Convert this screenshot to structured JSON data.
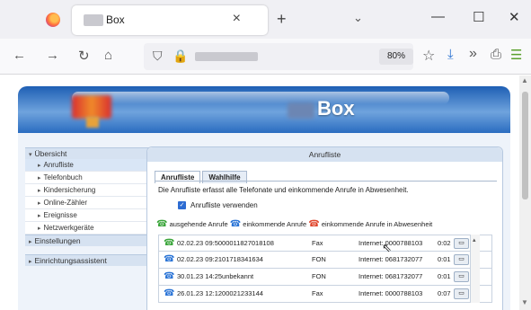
{
  "browser": {
    "tab_title": "Box",
    "tab_close": "×",
    "new_tab": "+",
    "tab_list": "⌄",
    "window_buttons": {
      "minimize": "—",
      "maximize": "☐",
      "close": "✕"
    },
    "nav": {
      "back": "←",
      "forward": "→",
      "reload": "↻",
      "home": "⌂"
    },
    "url_shield": "⛉",
    "url_lock": "🔒",
    "zoom_level": "80%",
    "toolbar": {
      "star": "☆",
      "download": "⤓",
      "more": "»",
      "share": "⎙",
      "extension": "☰"
    }
  },
  "page": {
    "banner_title": "Box",
    "sidebar": {
      "sections": [
        {
          "label": "Übersicht",
          "bullet": "▾",
          "items": [
            {
              "label": "Anrufliste",
              "active": true
            },
            {
              "label": "Telefonbuch"
            },
            {
              "label": "Kindersicherung"
            },
            {
              "label": "Online-Zähler"
            },
            {
              "label": "Ereignisse"
            },
            {
              "label": "Netzwerkgeräte"
            }
          ]
        },
        {
          "label": "Einstellungen",
          "bullet": "▸",
          "items": []
        },
        {
          "label": "Einrichtungsassistent",
          "bullet": "▸",
          "items": []
        }
      ]
    },
    "panel": {
      "header": "Anrufliste",
      "tabs": [
        "Anrufliste",
        "Wahlhilfe"
      ],
      "description": "Die Anrufliste erfasst alle Telefonate und einkommende Anrufe in Abwesenheit.",
      "checkbox_label": "Anrufliste verwenden",
      "checkbox_mark": "✓",
      "legend": {
        "outgoing": "ausgehende Anrufe",
        "incoming": "einkommende Anrufe",
        "missed": "einkommende Anrufe in Abwesenheit"
      },
      "calls": [
        {
          "datetime_number": "02.02.23 09:5000011827018108",
          "type": "Fax",
          "extension": "Internet: 0000788103",
          "duration": "0:02",
          "kind": "outgoing"
        },
        {
          "datetime_number": "02.02.23 09:2101718341634",
          "type": "FON",
          "extension": "Internet: 0681732077",
          "duration": "0:01",
          "kind": "incoming"
        },
        {
          "datetime_number": "30.01.23 14:25unbekannt",
          "type": "FON",
          "extension": "Internet: 0681732077",
          "duration": "0:01",
          "kind": "incoming"
        },
        {
          "datetime_number": "26.01.23 12:1200021233144",
          "type": "Fax",
          "extension": "Internet: 0000788103",
          "duration": "0:07",
          "kind": "incoming"
        }
      ],
      "row_button_icon": "▭",
      "list_scroll_up": "▴"
    },
    "cursor": "⇖"
  },
  "colors": {
    "banner_blue": "#1e5fb4",
    "outgoing_icon": "#3aa53a",
    "incoming_icon": "#2a74d6",
    "missed_icon": "#e0452b"
  }
}
